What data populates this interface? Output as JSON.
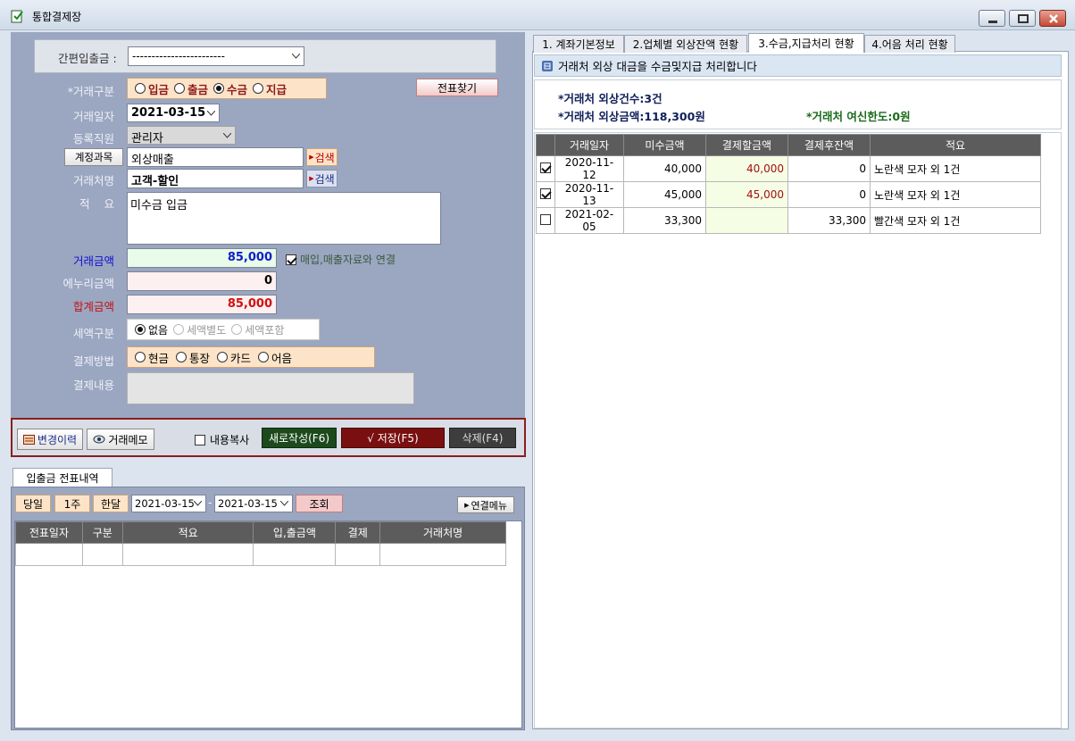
{
  "window": {
    "title": "통합결제장"
  },
  "form": {
    "quick_label": "간편입출금 :",
    "quick_value": "------------------------",
    "type_label": "*거래구분",
    "type_options": [
      "입금",
      "출금",
      "수금",
      "지급"
    ],
    "type_selected": "수금",
    "find_voucher": "전표찾기",
    "date_label": "거래일자",
    "date_value": "2021-03-15",
    "staff_label": "등록직원",
    "staff_value": "관리자",
    "account_btn": "계정과목",
    "account_value": "외상매출",
    "search": "검색",
    "partner_label": "거래처명",
    "partner_value": "고객-할인",
    "memo_label": "적    요",
    "memo_value": "미수금 입금",
    "amount_label": "거래금액",
    "amount_value": "85,000",
    "link_label": "매입,매출자료와 연결",
    "rounding_label": "에누리금액",
    "rounding_value": "0",
    "total_label": "합계금액",
    "total_value": "85,000",
    "tax_label": "세액구분",
    "tax_options": [
      "없음",
      "세액별도",
      "세액포함"
    ],
    "tax_selected": "없음",
    "pay_label": "결제방법",
    "pay_options": [
      "현금",
      "통장",
      "카드",
      "어음"
    ],
    "pay_content_label": "결제내용"
  },
  "actions": {
    "history": "변경이력",
    "memo": "거래메모",
    "copy": "내용복사",
    "new": "새로작성(F6)",
    "save": "√ 저장(F5)",
    "delete": "삭제(F4)"
  },
  "voucher": {
    "tab": "입출금 전표내역",
    "today": "당일",
    "week": "1주",
    "month": "한달",
    "from": "2021-03-15",
    "to": "2021-03-15",
    "dash": "-",
    "query": "조회",
    "link_menu": "연결메뉴",
    "columns": [
      "전표일자",
      "구분",
      "적요",
      "입,출금액",
      "결제",
      "거래처명"
    ]
  },
  "right": {
    "tabs": [
      "1. 계좌기본정보",
      "2.업체별 외상잔액 현황",
      "3.수금,지급처리 현황",
      "4.어음 처리 현황"
    ],
    "active_tab": 2,
    "info": "거래처 외상 대금을 수금및지급 처리합니다",
    "count": "*거래처 외상건수:3건",
    "amount": "*거래처 외상금액:118,300원",
    "credit": "*거래처 여신한도:0원",
    "columns": [
      "",
      "거래일자",
      "미수금액",
      "결제할금액",
      "결제후잔액",
      "적요"
    ],
    "rows": [
      {
        "checked": true,
        "date": "2020-11-12",
        "unpaid": "40,000",
        "pay": "40,000",
        "after": "0",
        "memo": "노란색 모자 외 1건"
      },
      {
        "checked": true,
        "date": "2020-11-13",
        "unpaid": "45,000",
        "pay": "45,000",
        "after": "0",
        "memo": "노란색 모자 외 1건"
      },
      {
        "checked": false,
        "date": "2021-02-05",
        "unpaid": "33,300",
        "pay": "",
        "after": "33,300",
        "memo": "빨간색 모자 외 1건"
      }
    ]
  }
}
